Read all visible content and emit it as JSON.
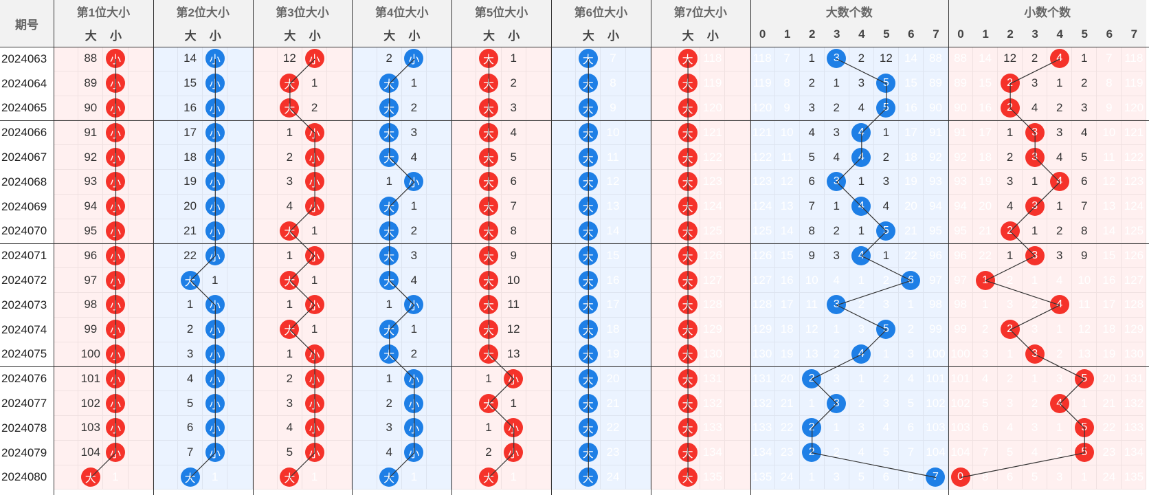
{
  "header": {
    "period_label": "期号",
    "groups": [
      "第1位大小",
      "第2位大小",
      "第3位大小",
      "第4位大小",
      "第5位大小",
      "第6位大小",
      "第7位大小",
      "大数个数",
      "小数个数"
    ],
    "big": "大",
    "small": "小",
    "count_labels": [
      "0",
      "1",
      "2",
      "3",
      "4",
      "5",
      "6",
      "7"
    ]
  },
  "colors": {
    "red": "#f5322a",
    "blue": "#1e7fe6",
    "gray": "#8c8c8c",
    "pink": "#fff0f0",
    "lightblue": "#ebf3ff"
  },
  "rows": [
    {
      "period": "2024063",
      "pos": [
        [
          "S",
          88
        ],
        [
          "S",
          14
        ],
        [
          "S",
          12
        ],
        [
          "S",
          2
        ],
        [
          "B",
          1
        ],
        [
          "B",
          7
        ],
        [
          "B",
          118
        ]
      ],
      "big": [
        118,
        7,
        1,
        "3",
        2,
        12,
        14,
        88
      ],
      "small": [
        88,
        14,
        12,
        2,
        "4",
        1,
        7,
        118
      ]
    },
    {
      "period": "2024064",
      "pos": [
        [
          "S",
          89
        ],
        [
          "S",
          15
        ],
        [
          "B",
          1
        ],
        [
          "B",
          1
        ],
        [
          "B",
          2
        ],
        [
          "B",
          8
        ],
        [
          "B",
          119
        ]
      ],
      "big": [
        119,
        8,
        2,
        1,
        3,
        "5",
        15,
        89
      ],
      "small": [
        89,
        15,
        "2",
        3,
        1,
        2,
        8,
        119
      ]
    },
    {
      "period": "2024065",
      "pos": [
        [
          "S",
          90
        ],
        [
          "S",
          16
        ],
        [
          "B",
          2
        ],
        [
          "B",
          2
        ],
        [
          "B",
          3
        ],
        [
          "B",
          9
        ],
        [
          "B",
          120
        ]
      ],
      "big": [
        120,
        9,
        3,
        2,
        4,
        "5",
        16,
        90
      ],
      "small": [
        90,
        16,
        "2",
        4,
        2,
        3,
        9,
        120
      ]
    },
    {
      "period": "2024066",
      "pos": [
        [
          "S",
          91
        ],
        [
          "S",
          17
        ],
        [
          "S",
          1
        ],
        [
          "B",
          3
        ],
        [
          "B",
          4
        ],
        [
          "B",
          10
        ],
        [
          "B",
          121
        ]
      ],
      "big": [
        121,
        10,
        4,
        3,
        "4",
        1,
        17,
        91
      ],
      "small": [
        91,
        17,
        1,
        "3",
        3,
        4,
        10,
        121
      ]
    },
    {
      "period": "2024067",
      "pos": [
        [
          "S",
          92
        ],
        [
          "S",
          18
        ],
        [
          "S",
          2
        ],
        [
          "B",
          4
        ],
        [
          "B",
          5
        ],
        [
          "B",
          11
        ],
        [
          "B",
          122
        ]
      ],
      "big": [
        122,
        11,
        5,
        4,
        "4",
        2,
        18,
        92
      ],
      "small": [
        92,
        18,
        2,
        "3",
        4,
        5,
        11,
        122
      ]
    },
    {
      "period": "2024068",
      "pos": [
        [
          "S",
          93
        ],
        [
          "S",
          19
        ],
        [
          "S",
          3
        ],
        [
          "S",
          1
        ],
        [
          "B",
          6
        ],
        [
          "B",
          12
        ],
        [
          "B",
          123
        ]
      ],
      "big": [
        123,
        12,
        6,
        "3",
        1,
        3,
        19,
        93
      ],
      "small": [
        93,
        19,
        3,
        1,
        "4",
        6,
        12,
        123
      ]
    },
    {
      "period": "2024069",
      "pos": [
        [
          "S",
          94
        ],
        [
          "S",
          20
        ],
        [
          "S",
          4
        ],
        [
          "B",
          1
        ],
        [
          "B",
          7
        ],
        [
          "B",
          13
        ],
        [
          "B",
          124
        ]
      ],
      "big": [
        124,
        13,
        7,
        1,
        "4",
        4,
        20,
        94
      ],
      "small": [
        94,
        20,
        4,
        "3",
        1,
        7,
        13,
        124
      ]
    },
    {
      "period": "2024070",
      "pos": [
        [
          "S",
          95
        ],
        [
          "S",
          21
        ],
        [
          "B",
          1
        ],
        [
          "B",
          2
        ],
        [
          "B",
          8
        ],
        [
          "B",
          14
        ],
        [
          "B",
          125
        ]
      ],
      "big": [
        125,
        14,
        8,
        2,
        1,
        "5",
        21,
        95
      ],
      "small": [
        95,
        21,
        "2",
        1,
        2,
        8,
        14,
        125
      ]
    },
    {
      "period": "2024071",
      "pos": [
        [
          "S",
          96
        ],
        [
          "S",
          22
        ],
        [
          "S",
          1
        ],
        [
          "B",
          3
        ],
        [
          "B",
          9
        ],
        [
          "B",
          15
        ],
        [
          "B",
          126
        ]
      ],
      "big": [
        126,
        15,
        9,
        3,
        "4",
        1,
        22,
        96
      ],
      "small": [
        96,
        22,
        1,
        "3",
        3,
        9,
        15,
        126
      ]
    },
    {
      "period": "2024072",
      "pos": [
        [
          "S",
          97
        ],
        [
          "B",
          1
        ],
        [
          "B",
          1
        ],
        [
          "B",
          4
        ],
        [
          "B",
          10
        ],
        [
          "B",
          16
        ],
        [
          "B",
          127
        ]
      ],
      "big": [
        127,
        16,
        10,
        4,
        1,
        2,
        "6",
        97
      ],
      "small": [
        97,
        "1",
        2,
        1,
        4,
        10,
        16,
        127
      ]
    },
    {
      "period": "2024073",
      "pos": [
        [
          "S",
          98
        ],
        [
          "S",
          1
        ],
        [
          "S",
          1
        ],
        [
          "S",
          1
        ],
        [
          "B",
          11
        ],
        [
          "B",
          17
        ],
        [
          "B",
          128
        ]
      ],
      "big": [
        128,
        17,
        11,
        "3",
        2,
        3,
        1,
        98
      ],
      "small": [
        98,
        1,
        3,
        2,
        "4",
        11,
        17,
        128
      ]
    },
    {
      "period": "2024074",
      "pos": [
        [
          "S",
          99
        ],
        [
          "S",
          2
        ],
        [
          "B",
          1
        ],
        [
          "B",
          1
        ],
        [
          "B",
          12
        ],
        [
          "B",
          18
        ],
        [
          "B",
          129
        ]
      ],
      "big": [
        129,
        18,
        12,
        1,
        3,
        "5",
        2,
        99
      ],
      "small": [
        99,
        2,
        "2",
        3,
        1,
        12,
        18,
        129
      ]
    },
    {
      "period": "2024075",
      "pos": [
        [
          "S",
          100
        ],
        [
          "S",
          3
        ],
        [
          "S",
          1
        ],
        [
          "B",
          2
        ],
        [
          "B",
          13
        ],
        [
          "B",
          19
        ],
        [
          "B",
          130
        ]
      ],
      "big": [
        130,
        19,
        13,
        2,
        "4",
        1,
        3,
        100
      ],
      "small": [
        100,
        3,
        1,
        "3",
        2,
        13,
        19,
        130
      ]
    },
    {
      "period": "2024076",
      "pos": [
        [
          "S",
          101
        ],
        [
          "S",
          4
        ],
        [
          "S",
          2
        ],
        [
          "S",
          1
        ],
        [
          "S",
          1
        ],
        [
          "B",
          20
        ],
        [
          "B",
          131
        ]
      ],
      "big": [
        131,
        20,
        "2",
        3,
        1,
        2,
        4,
        101
      ],
      "small": [
        101,
        4,
        2,
        1,
        3,
        "5",
        20,
        131
      ]
    },
    {
      "period": "2024077",
      "pos": [
        [
          "S",
          102
        ],
        [
          "S",
          5
        ],
        [
          "S",
          3
        ],
        [
          "S",
          2
        ],
        [
          "B",
          1
        ],
        [
          "B",
          21
        ],
        [
          "B",
          132
        ]
      ],
      "big": [
        132,
        21,
        1,
        "3",
        2,
        3,
        5,
        102
      ],
      "small": [
        102,
        5,
        3,
        2,
        "4",
        1,
        21,
        132
      ]
    },
    {
      "period": "2024078",
      "pos": [
        [
          "S",
          103
        ],
        [
          "S",
          6
        ],
        [
          "S",
          4
        ],
        [
          "S",
          3
        ],
        [
          "S",
          1
        ],
        [
          "B",
          22
        ],
        [
          "B",
          133
        ]
      ],
      "big": [
        133,
        22,
        "2",
        1,
        3,
        4,
        6,
        103
      ],
      "small": [
        103,
        6,
        4,
        3,
        1,
        "5",
        22,
        133
      ]
    },
    {
      "period": "2024079",
      "pos": [
        [
          "S",
          104
        ],
        [
          "S",
          7
        ],
        [
          "S",
          5
        ],
        [
          "S",
          4
        ],
        [
          "S",
          2
        ],
        [
          "B",
          23
        ],
        [
          "B",
          134
        ]
      ],
      "big": [
        134,
        23,
        "2",
        2,
        4,
        5,
        7,
        104
      ],
      "small": [
        104,
        7,
        5,
        4,
        2,
        "5",
        23,
        134
      ]
    },
    {
      "period": "2024080",
      "pos": [
        [
          "B",
          1
        ],
        [
          "B",
          1
        ],
        [
          "B",
          1
        ],
        [
          "B",
          1
        ],
        [
          "B",
          1
        ],
        [
          "B",
          24
        ],
        [
          "B",
          135
        ]
      ],
      "big": [
        135,
        24,
        1,
        3,
        5,
        6,
        8,
        "7"
      ],
      "small": [
        "0",
        8,
        6,
        5,
        3,
        1,
        24,
        135
      ]
    }
  ]
}
